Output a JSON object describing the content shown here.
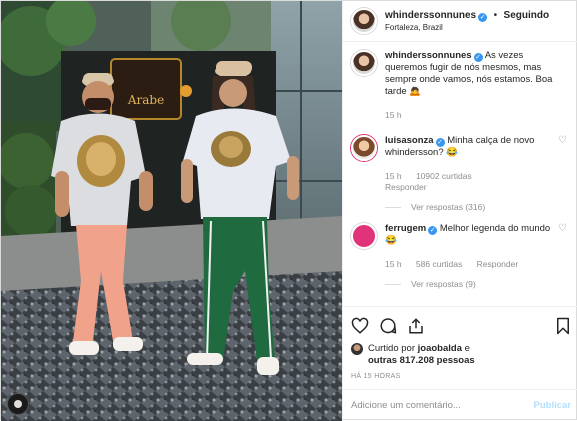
{
  "header": {
    "username": "whinderssonnunes",
    "verified_icon": "verified-badge-icon",
    "separator": "•",
    "follow_label": "Seguindo",
    "location": "Fortaleza, Brazil"
  },
  "photo": {
    "restaurant_sign": "Arabe"
  },
  "caption": {
    "username": "whinderssonnunes",
    "text": "As vezes queremos fugir de nós mesmos, mas sempre onde vamos, nós estamos. Boa tarde",
    "emoji": "🙇",
    "time": "15 h"
  },
  "comments": [
    {
      "username": "luisasonza",
      "text": "Minha calça de novo whindersson?",
      "emoji": "😂",
      "time": "15 h",
      "likes": "10902 curtidas",
      "reply_label": "Responder",
      "view_replies": "Ver respostas (316)"
    },
    {
      "username": "ferrugem",
      "text": "Melhor legenda do mundo",
      "emoji": "😂",
      "time": "15 h",
      "likes": "586 curtidas",
      "reply_label": "Responder",
      "view_replies": "Ver respostas (9)"
    }
  ],
  "actions": {
    "icons": [
      "heart-icon",
      "comment-icon",
      "share-icon",
      "bookmark-icon"
    ]
  },
  "likes": {
    "prefix": "Curtido por",
    "user": "joaobalda",
    "middle": "e",
    "others": "outras 817.208 pessoas"
  },
  "timestamp": "HÁ 15 HORAS",
  "add_comment": {
    "placeholder": "Adicione um comentário...",
    "publish_label": "Publicar"
  },
  "colors": {
    "link_blue": "#3897f0",
    "muted": "#8e8e8e",
    "publish_disabled": "#b2dffc"
  }
}
